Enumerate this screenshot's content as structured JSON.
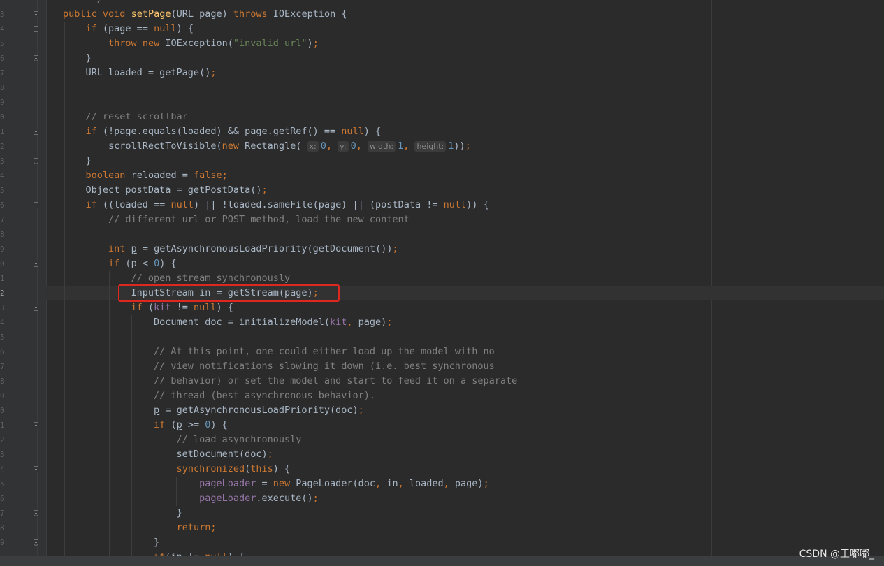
{
  "editor": {
    "language": "Java",
    "current_line_gutter": "2",
    "line_number_fragments": [
      "",
      "3",
      "4",
      "5",
      "6",
      "7",
      "8",
      "9",
      "0",
      "1",
      "2",
      "3",
      "4",
      "5",
      "6",
      "7",
      "8",
      "9",
      "0",
      "1",
      "2",
      "3",
      "4",
      "5",
      "6",
      "7",
      "8",
      "9",
      "0",
      "1",
      "2",
      "3",
      "4",
      "5",
      "6",
      "7",
      "8",
      "9",
      ""
    ],
    "code_lines": [
      "     */",
      "public void setPage(URL page) throws IOException {",
      "    if (page == null) {",
      "        throw new IOException(\"invalid url\");",
      "    }",
      "    URL loaded = getPage();",
      "",
      "",
      "    // reset scrollbar",
      "    if (!page.equals(loaded) && page.getRef() == null) {",
      "        scrollRectToVisible(new Rectangle( x: 0, y: 0, width: 1, height: 1));",
      "    }",
      "    boolean reloaded = false;",
      "    Object postData = getPostData();",
      "    if ((loaded == null) || !loaded.sameFile(page) || (postData != null)) {",
      "        // different url or POST method, load the new content",
      "",
      "        int p = getAsynchronousLoadPriority(getDocument());",
      "        if (p < 0) {",
      "            // open stream synchronously",
      "            InputStream in = getStream(page);",
      "            if (kit != null) {",
      "                Document doc = initializeModel(kit, page);",
      "",
      "                // At this point, one could either load up the model with no",
      "                // view notifications slowing it down (i.e. best synchronous",
      "                // behavior) or set the model and start to feed it on a separate",
      "                // thread (best asynchronous behavior).",
      "                p = getAsynchronousLoadPriority(doc);",
      "                if (p >= 0) {",
      "                    // load asynchronously",
      "                    setDocument(doc);",
      "                    synchronized(this) {",
      "                        pageLoader = new PageLoader(doc, in, loaded, page);",
      "                        pageLoader.execute();",
      "                    }",
      "                    return;",
      "                }",
      "                if(in != null) {"
    ],
    "highlighted_line": "InputStream in = getStream(page);"
  },
  "colors": {
    "background": "#2b2b2b",
    "keyword": "#cc7832",
    "method_declaration": "#ffc66d",
    "string": "#6a8759",
    "comment": "#808080",
    "number": "#6897bb",
    "field": "#9876aa",
    "default_text": "#a9b7c6",
    "annotation_box": "#e0271f"
  },
  "watermark": "CSDN @王嘟嘟_"
}
